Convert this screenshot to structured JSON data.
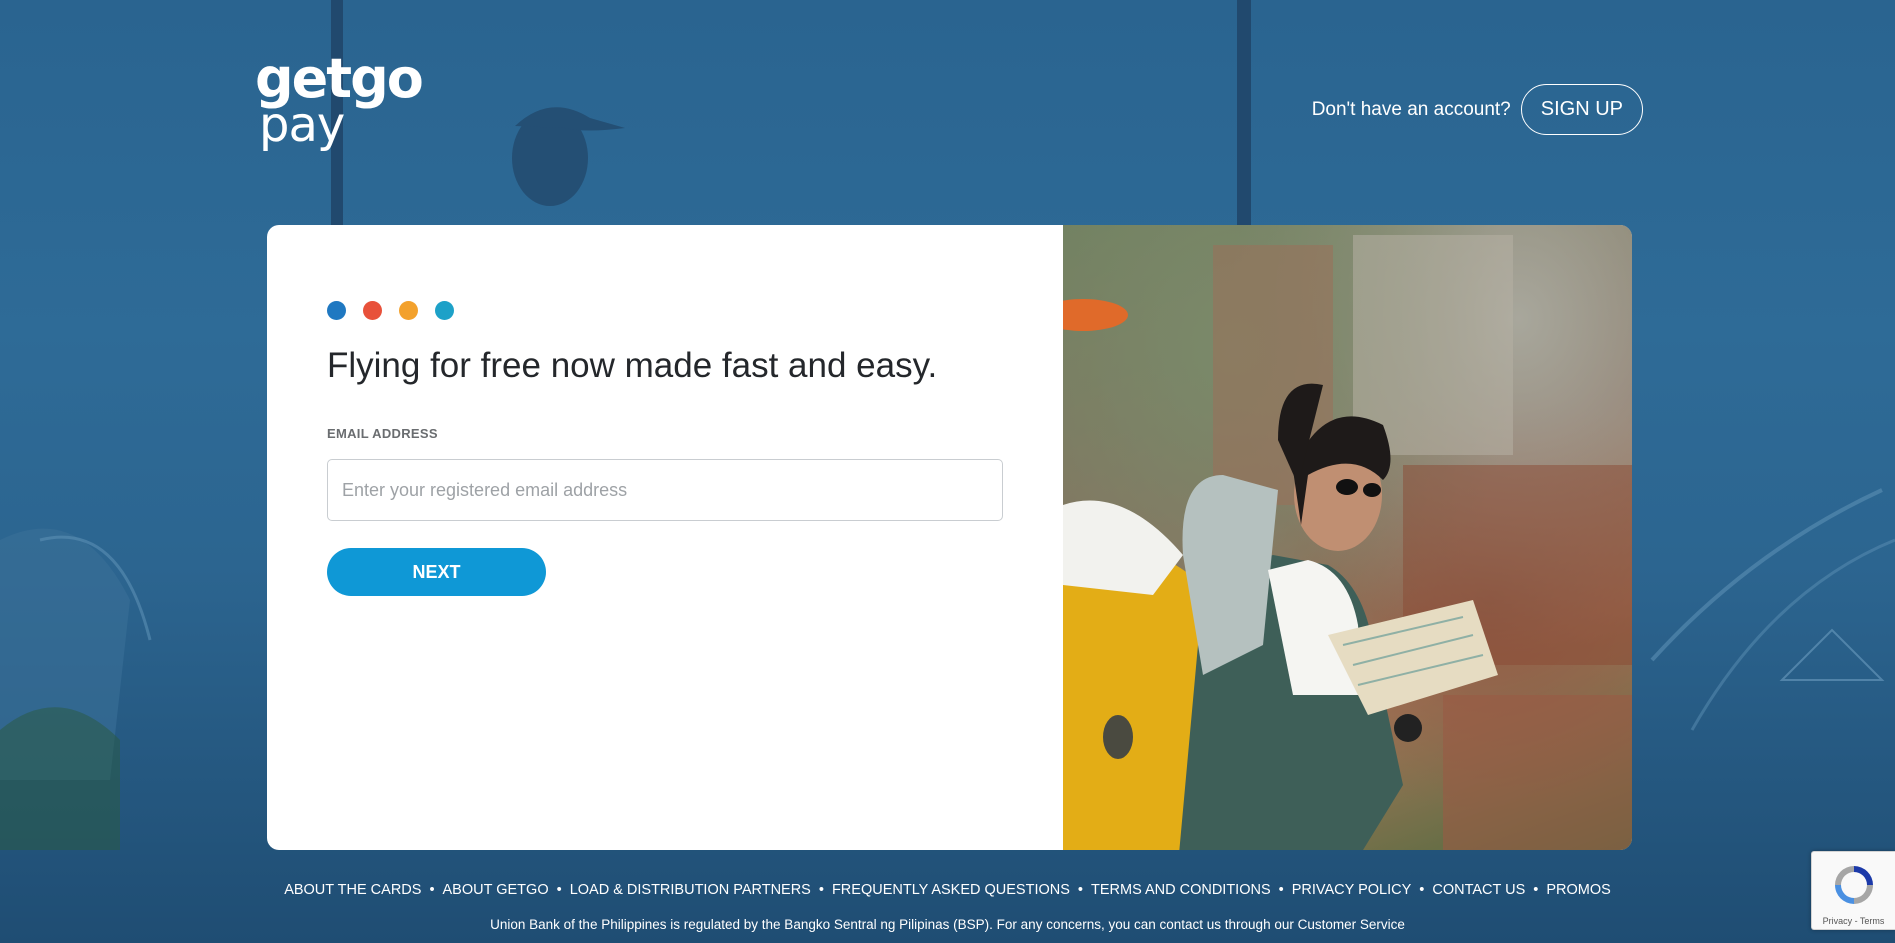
{
  "brand": {
    "logo_line1": "getgo",
    "logo_line2": "pay"
  },
  "header": {
    "account_question": "Don't have an account?",
    "signup_label": "SIGN UP"
  },
  "card": {
    "dot_colors": [
      "#1f78c1",
      "#e8513a",
      "#f3a12c",
      "#1da1c8"
    ],
    "headline": "Flying for free now made fast and easy.",
    "email_label": "EMAIL ADDRESS",
    "email_placeholder": "Enter your registered email address",
    "email_value": "",
    "next_label": "NEXT"
  },
  "footer": {
    "links": [
      "ABOUT THE CARDS",
      "ABOUT GETGO",
      "LOAD & DISTRIBUTION PARTNERS",
      "FREQUENTLY ASKED QUESTIONS",
      "TERMS AND CONDITIONS",
      "PRIVACY POLICY",
      "CONTACT US",
      "PROMOS"
    ],
    "separator": "•",
    "note": "Union Bank of the Philippines is regulated by the Bangko Sentral ng Pilipinas (BSP). For any concerns, you can contact us through our Customer Service"
  },
  "recaptcha": {
    "terms": "Privacy - Terms",
    "icon": "recaptcha-icon"
  }
}
